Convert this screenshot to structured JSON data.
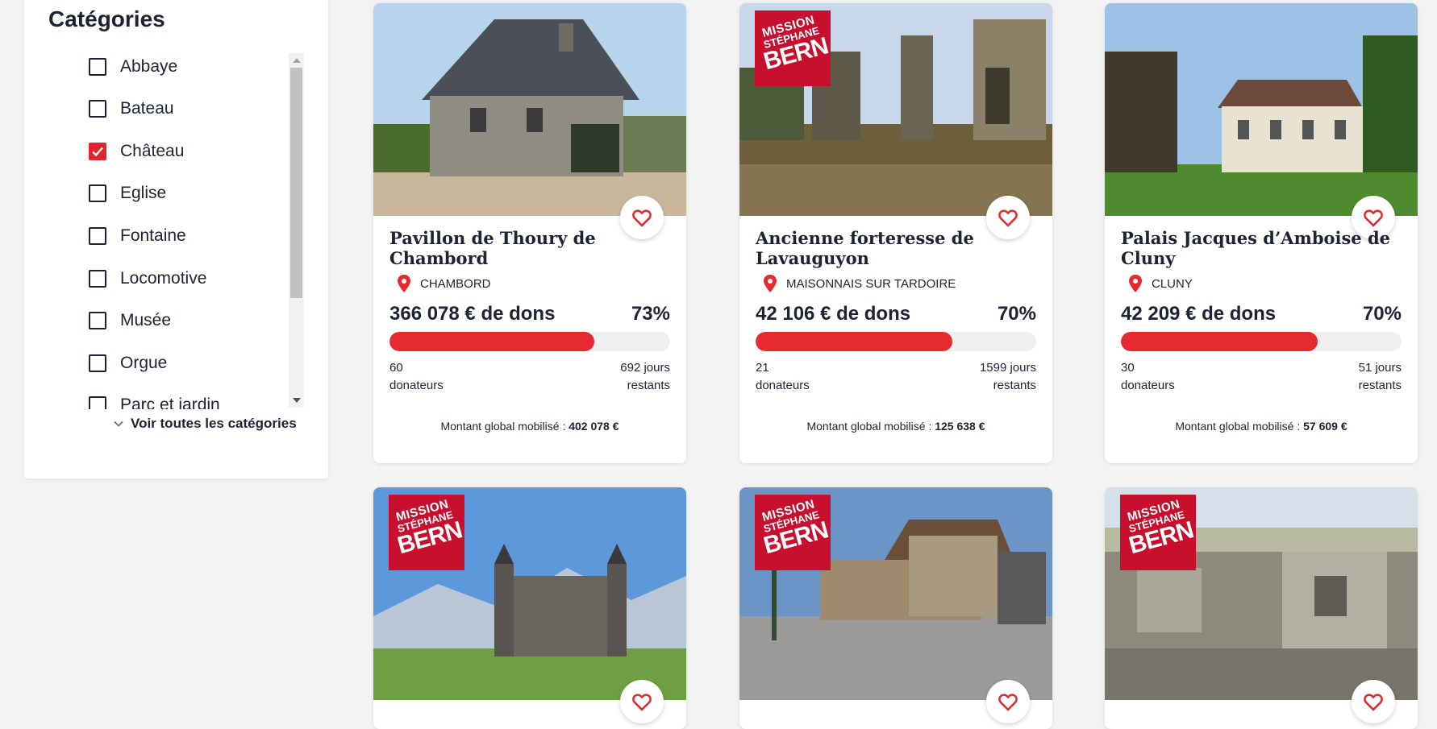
{
  "sidebar": {
    "title": "Catégories",
    "categories": [
      {
        "label": "Abbaye",
        "checked": false
      },
      {
        "label": "Bateau",
        "checked": false
      },
      {
        "label": "Château",
        "checked": true
      },
      {
        "label": "Eglise",
        "checked": false
      },
      {
        "label": "Fontaine",
        "checked": false
      },
      {
        "label": "Locomotive",
        "checked": false
      },
      {
        "label": "Musée",
        "checked": false
      },
      {
        "label": "Orgue",
        "checked": false
      },
      {
        "label": "Parc et jardin",
        "checked": false
      }
    ],
    "see_all": "Voir toutes les catégories"
  },
  "badge": {
    "line1": "MISSION",
    "line2": "STÉPHANE",
    "line3": "BERN"
  },
  "colors": {
    "accent": "#e52b30",
    "badge": "#c8102e",
    "text": "#1d2235"
  },
  "cards": [
    {
      "title": "Pavillon de Thoury de Chambord",
      "location": "CHAMBORD",
      "amount": "366 078 € de dons",
      "percent": "73%",
      "progress": 0.73,
      "donors_count": "60",
      "donors_label": "donateurs",
      "days_count": "692 jours",
      "days_label": "restants",
      "global_label": "Montant global mobilisé : ",
      "global_value": "402 078 €",
      "mission_badge": false
    },
    {
      "title": "Ancienne forteresse de Lavauguyon",
      "location": "MAISONNAIS SUR TARDOIRE",
      "amount": "42 106 € de dons",
      "percent": "70%",
      "progress": 0.7,
      "donors_count": "21",
      "donors_label": "donateurs",
      "days_count": "1599 jours",
      "days_label": "restants",
      "global_label": "Montant global mobilisé : ",
      "global_value": "125 638 €",
      "mission_badge": true
    },
    {
      "title": "Palais Jacques d’Amboise de Cluny",
      "location": "CLUNY",
      "amount": "42 209 € de dons",
      "percent": "70%",
      "progress": 0.7,
      "donors_count": "30",
      "donors_label": "donateurs",
      "days_count": "51 jours",
      "days_label": "restants",
      "global_label": "Montant global mobilisé : ",
      "global_value": "57 609 €",
      "mission_badge": false
    },
    {
      "mission_badge": true
    },
    {
      "mission_badge": true
    },
    {
      "mission_badge": true
    }
  ]
}
